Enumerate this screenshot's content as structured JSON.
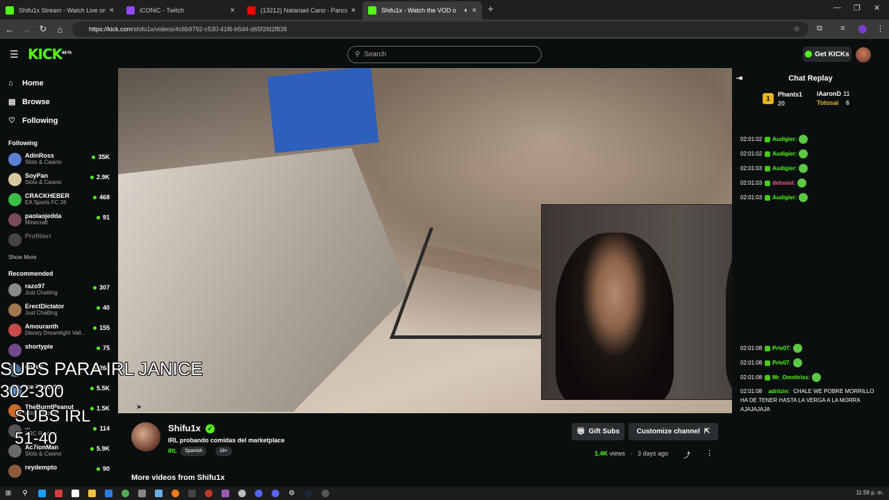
{
  "browser": {
    "tabs": [
      {
        "title": "Shifu1x Stream - Watch Live on",
        "color": "#53fc18"
      },
      {
        "title": "iCONiC - Twitch",
        "color": "#9146ff"
      },
      {
        "title": "(13212) Natanael Cano - Panca",
        "color": "#ff0000"
      },
      {
        "title": "Shifu1x - Watch the VOD o",
        "color": "#53fc18",
        "active": true
      }
    ],
    "url_host": "https://kick.com",
    "url_path": "/shifu1x/videos/4c6b9792-c530-41f6-b5d4-d65f2fd2f838"
  },
  "topnav": {
    "logo": "KICK",
    "logo_badge": "BETA",
    "search_placeholder": "Search",
    "get_kicks": "Get KICKs"
  },
  "sidebar": {
    "nav": [
      {
        "label": "Home",
        "icon": "home-icon",
        "glyph": "⌂"
      },
      {
        "label": "Browse",
        "icon": "browse-icon",
        "glyph": "▤"
      },
      {
        "label": "Following",
        "icon": "heart-icon",
        "glyph": "♡"
      }
    ],
    "following_title": "Following",
    "following": [
      {
        "name": "AdinRoss",
        "category": "Slots & Casino",
        "viewers": "35K",
        "color": "#5a7fd4"
      },
      {
        "name": "SoyPan",
        "category": "Slots & Casino",
        "viewers": "2.9K",
        "color": "#d8c8a0"
      },
      {
        "name": "CRACKHEBER",
        "category": "EA Sports FC 26",
        "viewers": "468",
        "color": "#3bbd4a"
      },
      {
        "name": "paolaojedda",
        "category": "Minecraft",
        "viewers": "91",
        "color": "#7a4a5a"
      },
      {
        "name": "Profitierr",
        "category": "",
        "viewers": "",
        "color": "#444444",
        "offline": true
      }
    ],
    "show_more": "Show More",
    "recommended_title": "Recommended",
    "recommended": [
      {
        "name": "razo97",
        "category": "Just Chatting",
        "viewers": "307",
        "color": "#8a8a8a"
      },
      {
        "name": "ErectDictator",
        "category": "Just Chatting",
        "viewers": "40",
        "color": "#a07850"
      },
      {
        "name": "Amouranth",
        "category": "Disney Dreamlight Vall...",
        "viewers": "155",
        "color": "#c84a4a"
      },
      {
        "name": "shortypie",
        "category": "",
        "viewers": "75",
        "color": "#704a8a"
      },
      {
        "name": "cuvey",
        "category": "",
        "viewers": "268",
        "color": "#4a6a8a"
      },
      {
        "name": "Ice Poseidon",
        "category": "",
        "viewers": "5.5K",
        "color": "#5a8ac8"
      },
      {
        "name": "TheBurntPeanut",
        "category": "ARC Raiders",
        "viewers": "1.5K",
        "color": "#c86a2a"
      },
      {
        "name": "...",
        "category": "ARC Raiders",
        "viewers": "114",
        "color": "#555555"
      },
      {
        "name": "Ac7ionMan",
        "category": "Slots & Casino",
        "viewers": "5.9K",
        "color": "#6a6a6a"
      },
      {
        "name": "reydempto",
        "category": "",
        "viewers": "90",
        "color": "#8a5a3a"
      }
    ]
  },
  "overlay": {
    "line1": "SUBS PARA IRL JANICE",
    "line2": "302-300",
    "line3": "SUBS IRL",
    "line4": "51-40"
  },
  "chat": {
    "title": "Chat Replay",
    "leaders": [
      {
        "rank": "1",
        "name": "Phants1",
        "count": "20"
      },
      {
        "rank": "",
        "name": "iAaronD",
        "count": "11"
      },
      {
        "rank": "",
        "name": "Totosai",
        "count": "6"
      }
    ],
    "messages_top": [
      {
        "time": "02:01:02",
        "user": "Audigier:",
        "color": "#53fc18"
      },
      {
        "time": "02:01:02",
        "user": "Audigier:",
        "color": "#53fc18"
      },
      {
        "time": "02:01:03",
        "user": "Audigier:",
        "color": "#53fc18"
      },
      {
        "time": "02:01:03",
        "user": "delusiol:",
        "color": "#ff5d8f"
      },
      {
        "time": "02:01:03",
        "user": "Audigier:",
        "color": "#53fc18"
      }
    ],
    "messages_bottom": [
      {
        "time": "02:01:08",
        "user": "Priv07:",
        "color": "#53fc18"
      },
      {
        "time": "02:01:08",
        "user": "Priv07:",
        "color": "#53fc18"
      },
      {
        "time": "02:01:08",
        "user": "Mr_Omnitrixx:",
        "color": "#53fc18"
      }
    ],
    "long_message": {
      "time": "02:01:08",
      "user": "adriizin:",
      "text": "CHALE WE POBRE MORRILLO HA DE TENER HASTA LA VERGA A LA MORRA AJAJAJAJA",
      "color": "#53fc18"
    }
  },
  "stream": {
    "name": "Shifu1x",
    "title": "IRL probando comidas del marketplace",
    "category": "IRL",
    "tags": [
      "Spanish",
      "18+"
    ],
    "gift_subs": "Gift Subs",
    "customize": "Customize channel",
    "views": "1.4K",
    "views_label": "views",
    "ago": "3 days ago",
    "more_videos": "More videos from Shifu1x"
  },
  "taskbar": {
    "clock": "11:59 p. m."
  },
  "colors": {
    "accent": "#53fc18",
    "bg": "#0b0e0f",
    "panel": "#2a2e30"
  }
}
